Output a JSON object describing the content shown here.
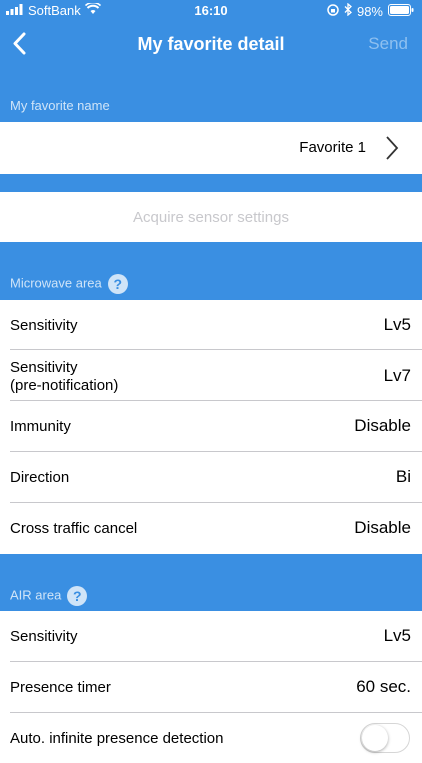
{
  "status": {
    "carrier": "SoftBank",
    "time": "16:10",
    "battery": "98%"
  },
  "nav": {
    "title": "My favorite detail",
    "send_label": "Send"
  },
  "favorite": {
    "section_label": "My favorite name",
    "value": "Favorite 1"
  },
  "acquire": {
    "label": "Acquire sensor settings"
  },
  "microwave": {
    "section_label": "Microwave area",
    "rows": [
      {
        "label": "Sensitivity",
        "value": "Lv5"
      },
      {
        "label": "Sensitivity\n(pre-notification)",
        "value": "Lv7"
      },
      {
        "label": "Immunity",
        "value": "Disable"
      },
      {
        "label": "Direction",
        "value": "Bi"
      },
      {
        "label": "Cross traffic cancel",
        "value": "Disable"
      }
    ]
  },
  "air": {
    "section_label": "AIR area",
    "rows": [
      {
        "label": "Sensitivity",
        "value": "Lv5"
      },
      {
        "label": "Presence timer",
        "value": "60 sec."
      },
      {
        "label": "Auto. infinite presence detection",
        "toggle_on": false
      }
    ]
  },
  "colors": {
    "accent": "#3a8fe2",
    "send_disabled": "#8ec0f0"
  }
}
